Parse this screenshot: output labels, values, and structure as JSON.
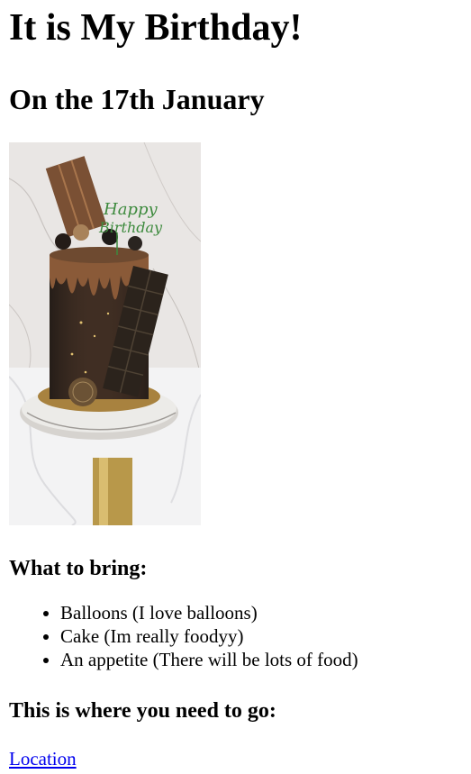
{
  "page": {
    "title": "It is My Birthday!",
    "subtitle": "On the 17th January",
    "image": {
      "icon": "birthday-cake-photo"
    },
    "bring_heading": "What to bring:",
    "bring_items": [
      "Balloons (I love balloons)",
      "Cake (Im really foodyy)",
      "An appetite (There will be lots of food)"
    ],
    "where_heading": "This is where you need to go:",
    "location_link": "Location"
  },
  "colors": {
    "link": "#0000ee",
    "text": "#000000",
    "background": "#ffffff"
  }
}
